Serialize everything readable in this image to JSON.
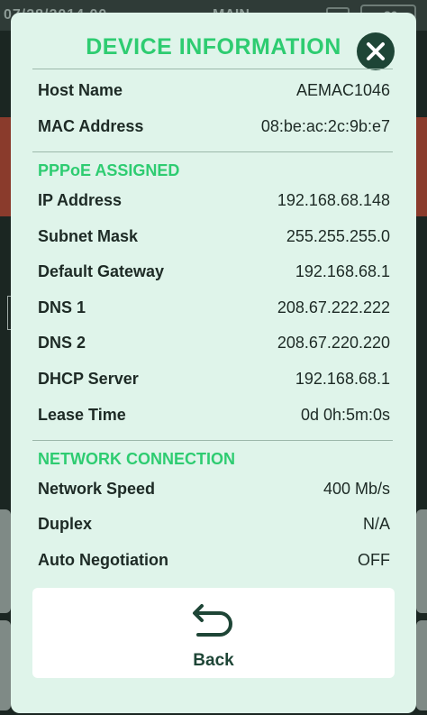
{
  "background": {
    "time_text": "07/28/2014 00",
    "title_text": "MAIN",
    "battery_text": "80"
  },
  "dialog": {
    "title": "DEVICE INFORMATION",
    "close_icon": "close-icon",
    "device": [
      {
        "label": "Host Name",
        "value": "AEMAC1046"
      },
      {
        "label": "MAC Address",
        "value": "08:be:ac:2c:9b:e7"
      }
    ],
    "pppoe_section": "PPPoE ASSIGNED",
    "pppoe": [
      {
        "label": "IP Address",
        "value": "192.168.68.148"
      },
      {
        "label": "Subnet Mask",
        "value": "255.255.255.0"
      },
      {
        "label": "Default Gateway",
        "value": "192.168.68.1"
      },
      {
        "label": "DNS 1",
        "value": "208.67.222.222"
      },
      {
        "label": "DNS 2",
        "value": "208.67.220.220"
      },
      {
        "label": "DHCP Server",
        "value": "192.168.68.1"
      },
      {
        "label": "Lease Time",
        "value": "0d 0h:5m:0s"
      }
    ],
    "network_section": "NETWORK CONNECTION",
    "network": [
      {
        "label": "Network Speed",
        "value": "400 Mb/s"
      },
      {
        "label": "Duplex",
        "value": "N/A"
      },
      {
        "label": "Auto Negotiation",
        "value": "OFF"
      }
    ],
    "back_label": "Back",
    "back_icon": "return-arrow-icon"
  },
  "colors": {
    "accent": "#2ecc71",
    "dialog_bg": "#dff4ea",
    "close_bg": "#1e4536",
    "text": "#1d2a25"
  }
}
